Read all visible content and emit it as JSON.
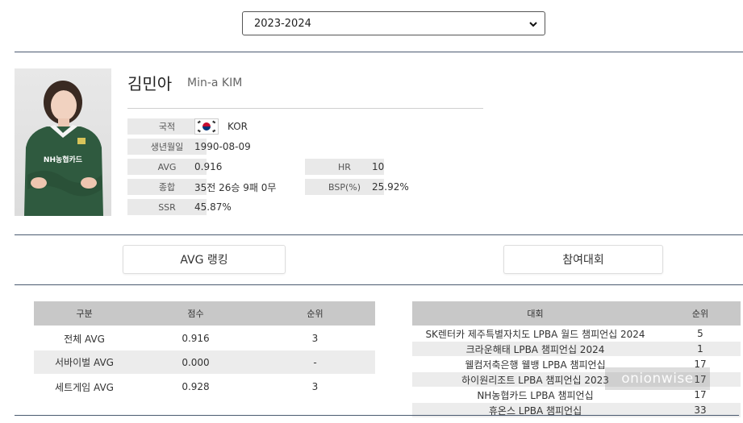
{
  "season": {
    "selected": "2023-2024"
  },
  "player": {
    "name_ko": "김민아",
    "name_en": "Min-a KIM",
    "photo_jersey_text": "NH농협카드",
    "fields": {
      "nationality_label": "국적",
      "nationality_value": "KOR",
      "birth_label": "생년월일",
      "birth_value": "1990-08-09",
      "avg_label": "AVG",
      "avg_value": "0.916",
      "hr_label": "HR",
      "hr_value": "10",
      "record_label": "종합",
      "record_value": "35전 26승 9패 0무",
      "bsp_label": "BSP(%)",
      "bsp_value": "25.92%",
      "ssr_label": "SSR",
      "ssr_value": "45.87%"
    }
  },
  "tabs": {
    "avg_ranking": "AVG 랭킹",
    "tournaments": "참여대회"
  },
  "avg_table": {
    "headers": [
      "구분",
      "점수",
      "순위"
    ],
    "rows": [
      {
        "category": "전체 AVG",
        "score": "0.916",
        "rank": "3"
      },
      {
        "category": "서바이벌 AVG",
        "score": "0.000",
        "rank": "-"
      },
      {
        "category": "세트게임 AVG",
        "score": "0.928",
        "rank": "3"
      }
    ]
  },
  "tournament_table": {
    "headers": [
      "대회",
      "순위"
    ],
    "rows": [
      {
        "name": "SK렌터카 제주특별자치도 LPBA 월드 챔피언십 2024",
        "rank": "5"
      },
      {
        "name": "크라운해태 LPBA 챔피언십 2024",
        "rank": "1"
      },
      {
        "name": "웰컴저축은행 웰뱅 LPBA 챔피언십",
        "rank": "17"
      },
      {
        "name": "하이원리조트 LPBA 챔피언십 2023",
        "rank": "17"
      },
      {
        "name": "NH농협카드 LPBA 챔피언십",
        "rank": "17"
      },
      {
        "name": "휴온스 LPBA 챔피언십",
        "rank": "33"
      }
    ]
  },
  "watermark": "onionwise"
}
